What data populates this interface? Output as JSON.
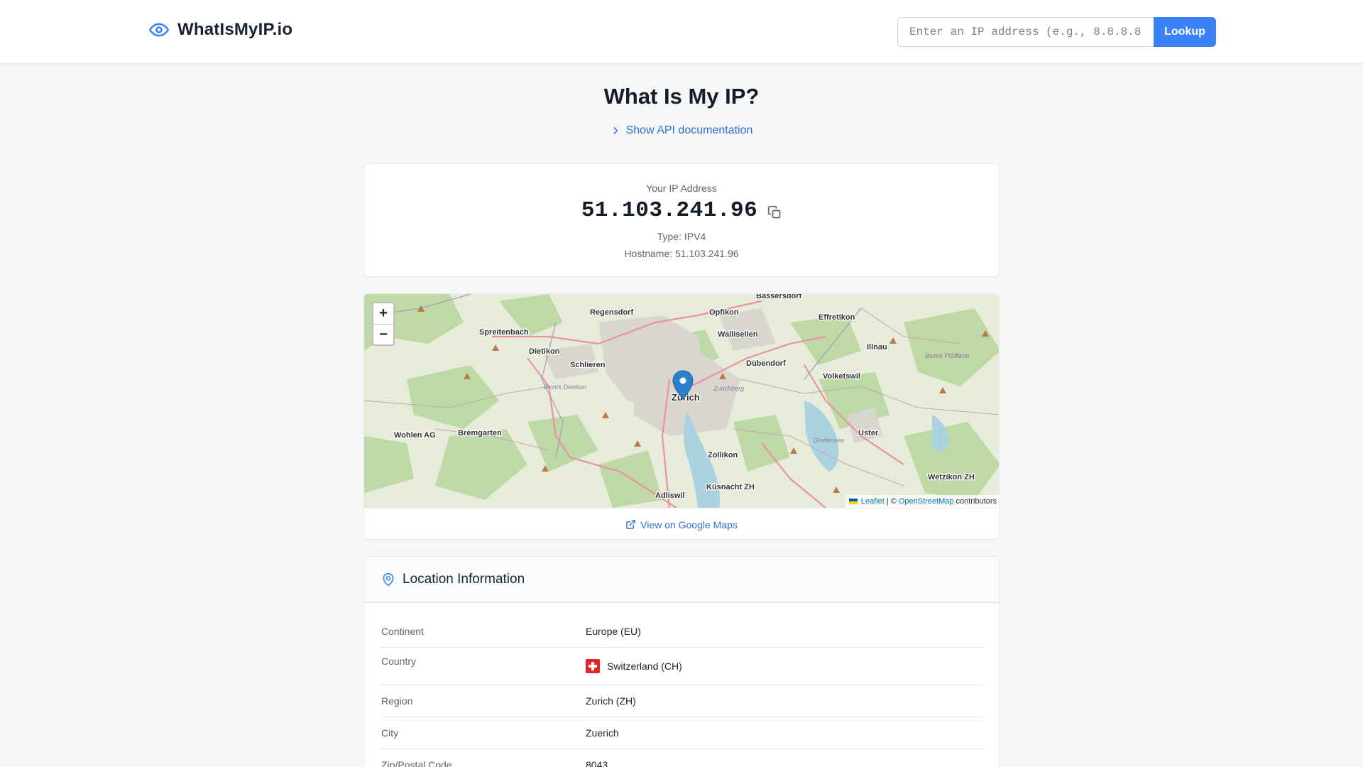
{
  "header": {
    "brand_name": "WhatIsMyIP.io",
    "brand_icon": "eye-icon",
    "search_placeholder": "Enter an IP address (e.g., 8.8.8.8",
    "search_value": "",
    "lookup_label": "Lookup"
  },
  "page": {
    "title": "What Is My IP?",
    "api_toggle_label": "Show API documentation"
  },
  "ip_card": {
    "label": "Your IP Address",
    "ip": "51.103.241.96",
    "type": "Type: IPV4",
    "hostname": "Hostname: 51.103.241.96"
  },
  "map": {
    "zoom_in": "+",
    "zoom_out": "−",
    "attribution_leaflet": "Leaflet",
    "attribution_sep": "| ©",
    "attribution_osm": "OpenStreetMap",
    "attribution_suffix": "contributors",
    "google_maps_label": "View on Google Maps",
    "place_labels": [
      "Bassersdorf",
      "Regensdorf",
      "Opfikon",
      "Effretikon",
      "Spreitenbach",
      "Wallisellen",
      "Illnau",
      "Dietikon",
      "Bezirk Pfäffikon",
      "Schlieren",
      "Dübendorf",
      "Volketswil",
      "Bezirk Dietikon",
      "Zurichberg",
      "Zurich",
      "Wohlen AG",
      "Bremgarten",
      "Uster",
      "Greifensee",
      "Zollikon",
      "Küsnacht ZH",
      "Wetzikon ZH",
      "Adliswil"
    ]
  },
  "location": {
    "title": "Location Information",
    "rows": [
      {
        "key": "Continent",
        "value": "Europe (EU)"
      },
      {
        "key": "Country",
        "value": "Switzerland (CH)"
      },
      {
        "key": "Region",
        "value": "Zurich (ZH)"
      },
      {
        "key": "City",
        "value": "Zuerich"
      },
      {
        "key": "Zip/Postal Code",
        "value": "8043"
      }
    ]
  },
  "colors": {
    "accent": "#3b82f6",
    "link": "#2f6fd4",
    "text": "#1b2332",
    "muted": "#5b6472"
  }
}
